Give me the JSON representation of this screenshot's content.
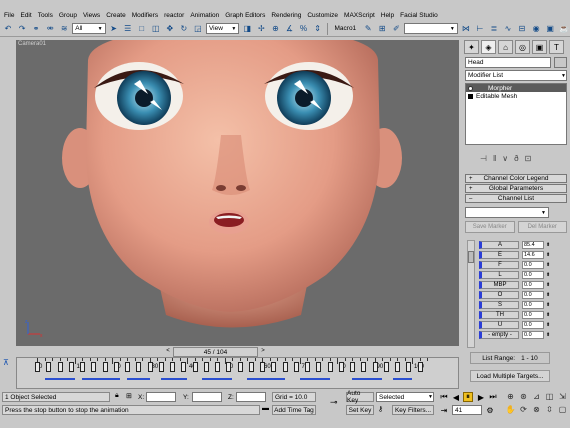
{
  "menu": [
    "File",
    "Edit",
    "Tools",
    "Group",
    "Views",
    "Create",
    "Modifiers",
    "reactor",
    "Animation",
    "Graph Editors",
    "Rendering",
    "Customize",
    "MAXScript",
    "Help",
    "Facial Studio"
  ],
  "toolbar": {
    "selection_filter": "All",
    "ref_coord": "View",
    "named_selection": "Macro1"
  },
  "viewport": {
    "label": "Camera01"
  },
  "command_panel": {
    "object_name": "Head",
    "modifier_list": "Modifier List",
    "stack": [
      {
        "label": "Morpher",
        "selected": true
      },
      {
        "label": "Editable Mesh",
        "selected": false
      }
    ],
    "rollouts": [
      "Channel Color Legend",
      "Global Parameters",
      "Channel List"
    ],
    "save_marker": "Save Marker",
    "del_marker": "Del Marker",
    "channels": [
      {
        "name": "A",
        "value": "85.4"
      },
      {
        "name": "E",
        "value": "14.6"
      },
      {
        "name": "F",
        "value": "0.0"
      },
      {
        "name": "L",
        "value": "0.0"
      },
      {
        "name": "MBP",
        "value": "0.0"
      },
      {
        "name": "O",
        "value": "0.0"
      },
      {
        "name": "S",
        "value": "0.0"
      },
      {
        "name": "TH",
        "value": "0.0"
      },
      {
        "name": "U",
        "value": "0.0"
      },
      {
        "name": "- empty -",
        "value": "0.0"
      }
    ],
    "list_range_label": "List Range:",
    "list_range_value": "1 - 10",
    "load_targets": "Load Multiple Targets..."
  },
  "timeline": {
    "frame_display": "45 / 104",
    "numbers": [
      "0",
      "10",
      "20",
      "30",
      "40",
      "50",
      "60",
      "70",
      "80",
      "90",
      "100"
    ]
  },
  "status": {
    "objects_selected": "1 Object Selected",
    "prompt": "Press the stop button to stop the animation",
    "x_label": "X:",
    "y_label": "Y:",
    "z_label": "Z:",
    "grid": "Grid = 10.0",
    "add_time_tag": "Add Time Tag",
    "auto_key": "Auto Key",
    "set_key": "Set Key",
    "key_mode": "Selected",
    "key_filters": "Key Filters...",
    "current_frame": "41"
  }
}
